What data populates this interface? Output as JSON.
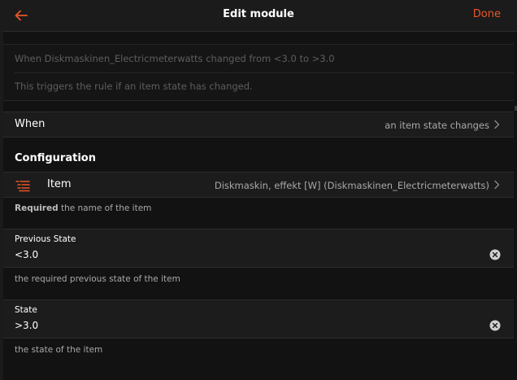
{
  "navbar": {
    "title": "Edit module",
    "done_label": "Done",
    "back_icon": "arrow-left-icon",
    "accent_color": "#e8562a"
  },
  "description": {
    "summary": "When Diskmaskinen_Electricmeterwatts changed from <3.0 to >3.0",
    "explanation": "This triggers the rule if an item state has changed."
  },
  "when": {
    "label": "When",
    "value": "an item state changes"
  },
  "configuration": {
    "title": "Configuration",
    "item": {
      "label": "Item",
      "value": "Diskmaskin, effekt [W] (Diskmaskinen_Electricmeterwatts)",
      "icon": "list-icon"
    },
    "item_helper_bold": "Required",
    "item_helper_text": " the name of the item",
    "previous_state": {
      "label": "Previous State",
      "value": "<3.0",
      "helper": "the required previous state of the item"
    },
    "state": {
      "label": "State",
      "value": ">3.0",
      "helper": "the state of the item"
    }
  }
}
